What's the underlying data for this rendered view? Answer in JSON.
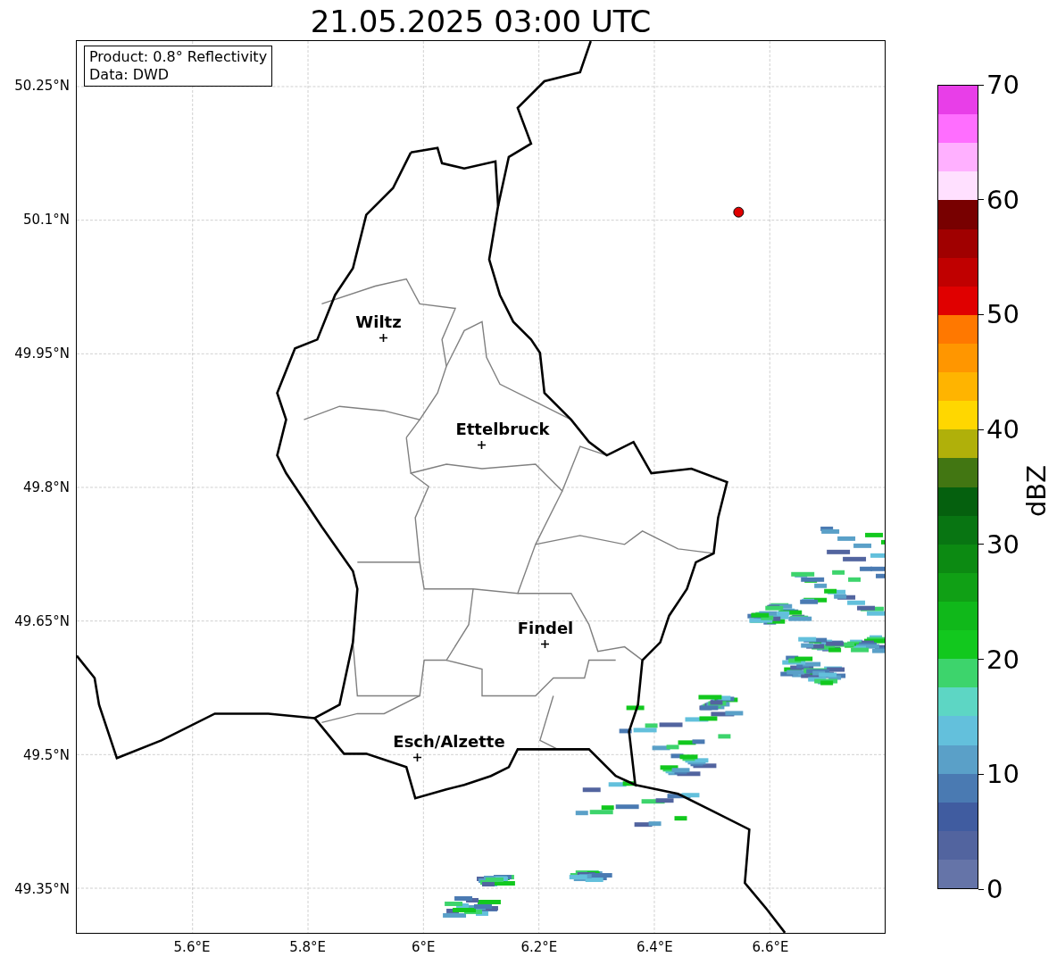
{
  "title": "21.05.2025 03:00 UTC",
  "info_box": {
    "lines": [
      "Product: 0.8° Reflectivity",
      "Data: DWD"
    ]
  },
  "y_ticks": [
    "50.25°N",
    "50.1°N",
    "49.95°N",
    "49.8°N",
    "49.65°N",
    "49.5°N",
    "49.35°N"
  ],
  "x_ticks": [
    "5.6°E",
    "5.8°E",
    "6°E",
    "6.2°E",
    "6.4°E",
    "6.6°E"
  ],
  "cities": [
    {
      "name": "Wiltz"
    },
    {
      "name": "Ettelbruck"
    },
    {
      "name": "Findel"
    },
    {
      "name": "Esch/Alzette"
    }
  ],
  "colorbar": {
    "label": "dBZ",
    "ticks": [
      "70",
      "60",
      "50",
      "40",
      "30",
      "20",
      "10",
      "0"
    ],
    "segments": [
      {
        "color": "#e83ee8"
      },
      {
        "color": "#ff6eff"
      },
      {
        "color": "#ffb0ff"
      },
      {
        "color": "#ffe0ff"
      },
      {
        "color": "#780000"
      },
      {
        "color": "#a00000"
      },
      {
        "color": "#c00000"
      },
      {
        "color": "#e00000"
      },
      {
        "color": "#ff7800"
      },
      {
        "color": "#ff9600"
      },
      {
        "color": "#ffb400"
      },
      {
        "color": "#ffd700"
      },
      {
        "color": "#b0b00a"
      },
      {
        "color": "#427612"
      },
      {
        "color": "#05600e"
      },
      {
        "color": "#087512"
      },
      {
        "color": "#0c8a12"
      },
      {
        "color": "#10a015"
      },
      {
        "color": "#10b81a"
      },
      {
        "color": "#12c81e"
      },
      {
        "color": "#3dd46c"
      },
      {
        "color": "#5dd6c4"
      },
      {
        "color": "#63c0dc"
      },
      {
        "color": "#5aa0c8"
      },
      {
        "color": "#4a7ab2"
      },
      {
        "color": "#405ca0"
      },
      {
        "color": "#52649f"
      },
      {
        "color": "#6574a8"
      }
    ]
  }
}
